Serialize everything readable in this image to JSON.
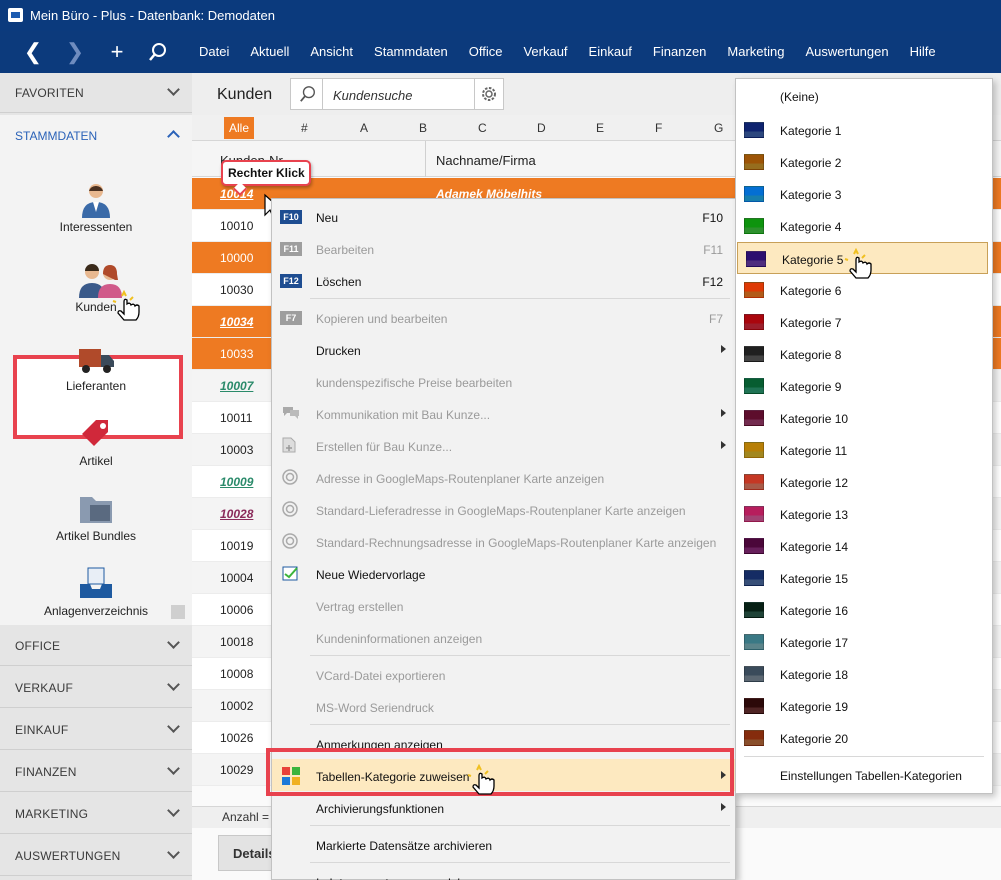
{
  "window": {
    "title": "Mein Büro - Plus - Datenbank: Demodaten"
  },
  "nav": {
    "back": "❮",
    "forward": "❯",
    "add": "+",
    "menu": [
      "Datei",
      "Aktuell",
      "Ansicht",
      "Stammdaten",
      "Office",
      "Verkauf",
      "Einkauf",
      "Finanzen",
      "Marketing",
      "Auswertungen",
      "Hilfe"
    ]
  },
  "sidebar": {
    "favoriten": "FAVORITEN",
    "stammdaten": "STAMMDATEN",
    "items": [
      "Interessenten",
      "Kunden",
      "Lieferanten",
      "Artikel",
      "Artikel Bundles",
      "Anlagenverzeichnis"
    ],
    "sections": [
      "OFFICE",
      "VERKAUF",
      "EINKAUF",
      "FINANZEN",
      "MARKETING",
      "AUSWERTUNGEN"
    ]
  },
  "main": {
    "title": "Kunden",
    "search_placeholder": "Kundensuche",
    "alpha": {
      "all": "Alle",
      "letters": [
        "#",
        "A",
        "B",
        "C",
        "D",
        "E",
        "F",
        "G"
      ]
    },
    "columns": {
      "nr": "Kunden-Nr.",
      "name": "Nachname/Firma"
    },
    "rows": [
      {
        "nr": "10014",
        "name": "Adamek Möbelhits",
        "style": "sel",
        "link": true
      },
      {
        "nr": "10010",
        "style": "",
        "link": false
      },
      {
        "nr": "10000",
        "style": "sel",
        "link": false
      },
      {
        "nr": "10030",
        "style": "",
        "link": false
      },
      {
        "nr": "10034",
        "style": "sel",
        "link": true
      },
      {
        "nr": "10033",
        "style": "sel",
        "link": false
      },
      {
        "nr": "10007",
        "style": "alt",
        "link": true,
        "color": "#2a8a6a"
      },
      {
        "nr": "10011",
        "style": "",
        "link": false
      },
      {
        "nr": "10003",
        "style": "alt",
        "link": false
      },
      {
        "nr": "10009",
        "style": "",
        "link": true,
        "color": "#2a8a6a"
      },
      {
        "nr": "10028",
        "style": "alt",
        "link": true,
        "color": "#8a2a5a"
      },
      {
        "nr": "10019",
        "style": "",
        "link": false
      },
      {
        "nr": "10004",
        "style": "alt",
        "link": false
      },
      {
        "nr": "10006",
        "style": "",
        "link": false
      },
      {
        "nr": "10018",
        "style": "alt",
        "link": false
      },
      {
        "nr": "10008",
        "style": "",
        "link": false
      },
      {
        "nr": "10002",
        "style": "alt",
        "link": false
      },
      {
        "nr": "10026",
        "style": "",
        "link": false
      },
      {
        "nr": "10029",
        "style": "alt",
        "link": false
      }
    ],
    "count_label": "Anzahl =",
    "details": "Details"
  },
  "tooltip": "Rechter Klick",
  "context_menu": [
    {
      "key": "F10",
      "label": "Neu",
      "shortcut": "F10",
      "enabled": true
    },
    {
      "key": "F11",
      "label": "Bearbeiten",
      "shortcut": "F11",
      "enabled": false
    },
    {
      "key": "F12",
      "label": "Löschen",
      "shortcut": "F12",
      "enabled": true
    },
    {
      "sep": true
    },
    {
      "key": "F7",
      "label": "Kopieren und bearbeiten",
      "shortcut": "F7",
      "enabled": false
    },
    {
      "label": "Drucken",
      "enabled": true,
      "sub": true
    },
    {
      "label": "kundenspezifische Preise bearbeiten",
      "enabled": false
    },
    {
      "label": "Kommunikation mit Bau Kunze...",
      "enabled": false,
      "sub": true,
      "icon": "chat-icon"
    },
    {
      "label": "Erstellen für Bau Kunze...",
      "enabled": false,
      "sub": true,
      "icon": "new-doc-icon"
    },
    {
      "label": "Adresse in GoogleMaps-Routenplaner Karte anzeigen",
      "enabled": false,
      "icon": "target-icon"
    },
    {
      "label": "Standard-Lieferadresse in GoogleMaps-Routenplaner Karte anzeigen",
      "enabled": false,
      "icon": "target-icon"
    },
    {
      "label": "Standard-Rechnungsadresse in GoogleMaps-Routenplaner Karte anzeigen",
      "enabled": false,
      "icon": "target-icon"
    },
    {
      "label": "Neue Wiedervorlage",
      "enabled": true,
      "icon": "reminder-icon"
    },
    {
      "label": "Vertrag erstellen",
      "enabled": false
    },
    {
      "label": "Kundeninformationen anzeigen",
      "enabled": false
    },
    {
      "sep": true
    },
    {
      "label": "VCard-Datei exportieren",
      "enabled": false
    },
    {
      "label": "MS-Word Seriendruck",
      "enabled": false
    },
    {
      "sep": true
    },
    {
      "label": "Anmerkungen anzeigen",
      "enabled": true
    },
    {
      "label": "Tabellen-Kategorie zuweisen",
      "enabled": true,
      "sub": true,
      "icon": "tiles-icon",
      "highlight": true
    },
    {
      "label": "Archivierungsfunktionen",
      "enabled": true,
      "sub": true
    },
    {
      "sep": true
    },
    {
      "label": "Markierte Datensätze archivieren",
      "enabled": true
    },
    {
      "sep": true
    },
    {
      "label": "In Interessenten umwandeln",
      "enabled": true
    }
  ],
  "categories": {
    "none": "(Keine)",
    "items": [
      {
        "label": "Kategorie 1",
        "color": "#3b5fa8"
      },
      {
        "label": "Kategorie 2",
        "color": "#c89228"
      },
      {
        "label": "Kategorie 3",
        "color": "#1ea8e8"
      },
      {
        "label": "Kategorie 4",
        "color": "#3cc23c"
      },
      {
        "label": "Kategorie 5",
        "color": "#6a3ca8"
      },
      {
        "label": "Kategorie 6",
        "color": "#ee7a22"
      },
      {
        "label": "Kategorie 7",
        "color": "#d0283a"
      },
      {
        "label": "Kategorie 8",
        "color": "#5a5a5a"
      },
      {
        "label": "Kategorie 9",
        "color": "#2a9a70"
      },
      {
        "label": "Kategorie 10",
        "color": "#9a3a6a"
      },
      {
        "label": "Kategorie 11",
        "color": "#d8b42a"
      },
      {
        "label": "Kategorie 12",
        "color": "#e07860"
      },
      {
        "label": "Kategorie 13",
        "color": "#d8589a"
      },
      {
        "label": "Kategorie 14",
        "color": "#8a2a7a"
      },
      {
        "label": "Kategorie 15",
        "color": "#4a6aa0"
      },
      {
        "label": "Kategorie 16",
        "color": "#2a5a4a"
      },
      {
        "label": "Kategorie 17",
        "color": "#7ab0b8"
      },
      {
        "label": "Kategorie 18",
        "color": "#7a8a98"
      },
      {
        "label": "Kategorie 19",
        "color": "#6a3030"
      },
      {
        "label": "Kategorie 20",
        "color": "#b86a3a"
      }
    ],
    "settings": "Einstellungen Tabellen-Kategorien"
  }
}
